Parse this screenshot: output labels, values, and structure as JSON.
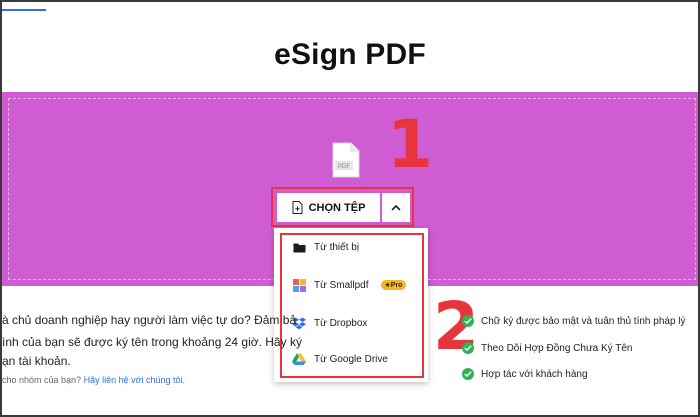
{
  "title": "eSign PDF",
  "upload": {
    "file_icon_label": "PDF",
    "choose_button_label": "CHỌN TỆP",
    "file_icon": "document-plus-icon",
    "toggle_icon": "chevron-up-icon",
    "background_color": "#cf5cd2"
  },
  "dropdown": {
    "items": [
      {
        "label": "Từ thiết bị",
        "icon": "folder-icon"
      },
      {
        "label": "Từ Smallpdf",
        "icon": "smallpdf-icon",
        "badge": "★Pro"
      },
      {
        "label": "Từ Dropbox",
        "icon": "dropbox-icon"
      },
      {
        "label": "Từ Google Drive",
        "icon": "google-drive-icon"
      }
    ]
  },
  "annotations": {
    "step1": "1",
    "step2": "2",
    "highlight_color": "#e8343c"
  },
  "description": {
    "lines": [
      "à chủ doanh nghiệp hay người làm việc tự do? Đảm bả",
      "ình của bạn sẽ được ký tên trong khoảng 24 giờ. Hãy ký",
      "ạn tài khoản."
    ],
    "contact_prefix": "cho nhóm của bạn?",
    "contact_link": "Hãy liên hệ với chúng tôi."
  },
  "features": [
    "Chữ ký được bảo mật và tuân thủ tính pháp lý",
    "Theo Dõi Hợp Đồng Chưa Ký Tên",
    "Hợp tác với khách hàng"
  ],
  "check_color": "#2fb457"
}
